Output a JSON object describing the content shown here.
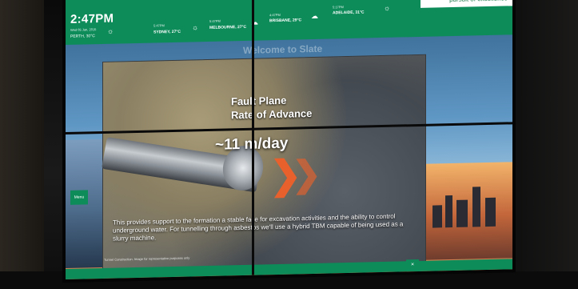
{
  "header": {
    "time": "2:47PM",
    "date": "Wed 05 Jan, 2015",
    "perth": "PERTH, 30°C",
    "cities": [
      {
        "time": "5:47PM",
        "name": "SYDNEY, 27°C"
      },
      {
        "time": "5:47PM",
        "name": "MELBOURNE, 27°C"
      },
      {
        "time": "4:47PM",
        "name": "BRISBANE, 29°C"
      },
      {
        "time": "5:17PM",
        "name": "ADELAIDE, 31°C"
      }
    ],
    "brand": "pursuit of excellence"
  },
  "panel": {
    "ghost_title": "Welcome to Slate",
    "fault": "Fault Plane",
    "rate": "Rate of Advance",
    "speed": "~11 m/day",
    "caption": "This provides support to the formation a stable face for excavation activities and the ability to control underground water. For tunnelling through asbestos we'll use a hybrid TBM capable of being used as a slurry machine."
  },
  "controls": {
    "menu": "Menu",
    "close": "×",
    "footer": "Tunnel Construction. Image for representative purposes only"
  },
  "colors": {
    "brand_green": "#0d8c5a",
    "accent_orange": "#e8612c"
  }
}
